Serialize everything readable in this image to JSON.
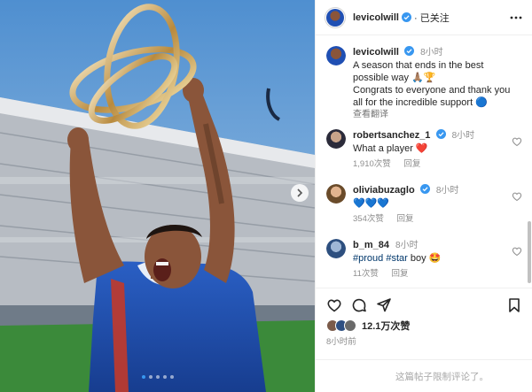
{
  "post": {
    "author": "levicolwill",
    "follow_state": "· 已关注",
    "caption_time": "8小时",
    "caption_lines": [
      "A season that ends in the best",
      "possible way 🙏🏽🏆",
      "Congrats to everyone and thank you",
      "all for the incredible support 🔵"
    ],
    "see_translation": "查看翻译",
    "likes": "12.1万次赞",
    "posted": "8小时前",
    "comments_disabled": "这篇帖子限制评论了。"
  },
  "comments": [
    {
      "user": "robertsanchez_1",
      "time": "8小时",
      "text": "What a player ❤️",
      "likes": "1,910次赞",
      "reply": "回复",
      "verified": true
    },
    {
      "user": "oliviabuzaglo",
      "time": "8小时",
      "text": "💙💙💙",
      "likes": "354次赞",
      "reply": "回复",
      "verified": true
    },
    {
      "user": "b_m_84",
      "time": "8小时",
      "text_pre": "",
      "tags": [
        "#proud",
        "#star"
      ],
      "text_post": "boy 🤩",
      "likes": "11次赞",
      "reply": "回复",
      "verified": false
    }
  ],
  "colors": {
    "verified_blue": "#3897f0",
    "jersey_blue": "#1f4fb3",
    "sky": "#6aa3d6",
    "pitch_green": "#3b8a3a"
  },
  "icons": [
    "more-icon",
    "verified-icon",
    "heart-outline-icon",
    "comment-icon",
    "share-icon",
    "bookmark-icon",
    "chevron-right-icon"
  ]
}
